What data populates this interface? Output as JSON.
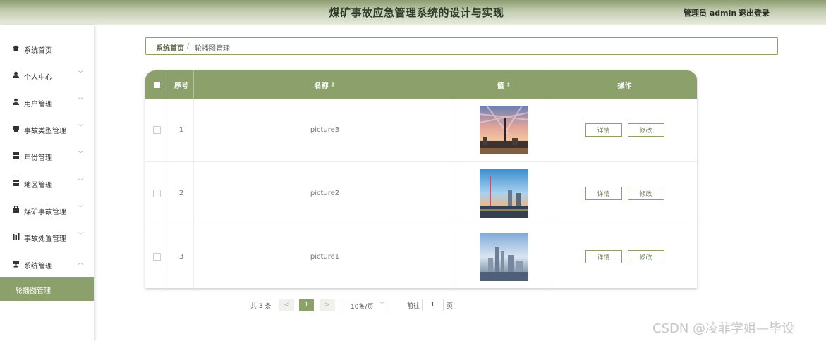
{
  "header": {
    "title": "煤矿事故应急管理系统的设计与实现",
    "user": "管理员 admin",
    "logout": "退出登录"
  },
  "sidebar": {
    "items": [
      {
        "label": "系统首页",
        "icon": "home-icon",
        "expandable": false
      },
      {
        "label": "个人中心",
        "icon": "person-icon",
        "expandable": true
      },
      {
        "label": "用户管理",
        "icon": "person-icon",
        "expandable": true
      },
      {
        "label": "事故类型管理",
        "icon": "card-icon",
        "expandable": true
      },
      {
        "label": "年份管理",
        "icon": "grid-icon",
        "expandable": true
      },
      {
        "label": "地区管理",
        "icon": "grid-icon",
        "expandable": true
      },
      {
        "label": "煤矿事故管理",
        "icon": "briefcase-icon",
        "expandable": true
      },
      {
        "label": "事故处置管理",
        "icon": "chart-icon",
        "expandable": true
      },
      {
        "label": "系统管理",
        "icon": "system-icon",
        "expandable": true,
        "expanded": true
      }
    ],
    "active_sub": "轮播图管理"
  },
  "breadcrumb": {
    "home": "系统首页",
    "separator": "/",
    "current": "轮播图管理"
  },
  "table": {
    "headers": {
      "index": "序号",
      "name": "名称",
      "value": "值",
      "actions": "操作"
    },
    "rows": [
      {
        "index": "1",
        "name": "picture3",
        "detail": "详情",
        "edit": "修改"
      },
      {
        "index": "2",
        "name": "picture2",
        "detail": "详情",
        "edit": "修改"
      },
      {
        "index": "3",
        "name": "picture1",
        "detail": "详情",
        "edit": "修改"
      }
    ]
  },
  "pagination": {
    "total": "共 3 条",
    "prev": "<",
    "current": "1",
    "next": ">",
    "page_size": "10条/页",
    "goto_label": "前往",
    "goto_value": "1",
    "page_label": "页"
  },
  "watermark": "CSDN @凌菲学姐—毕设",
  "colors": {
    "accent": "#8ba06b",
    "header_dark": "#8d9d70"
  }
}
